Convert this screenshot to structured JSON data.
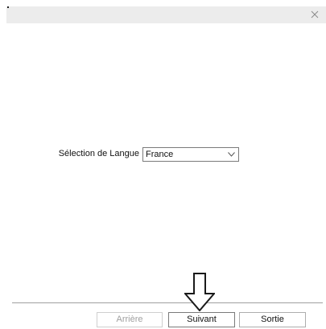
{
  "window": {
    "close_icon": "close-icon"
  },
  "language": {
    "label": "Sélection de Langue",
    "selected": "France",
    "chevron_icon": "chevron-down-icon"
  },
  "buttons": {
    "back_label": "Arrière",
    "back_enabled": false,
    "next_label": "Suivant",
    "exit_label": "Sortie"
  },
  "annotation": {
    "icon": "down-arrow-icon"
  }
}
